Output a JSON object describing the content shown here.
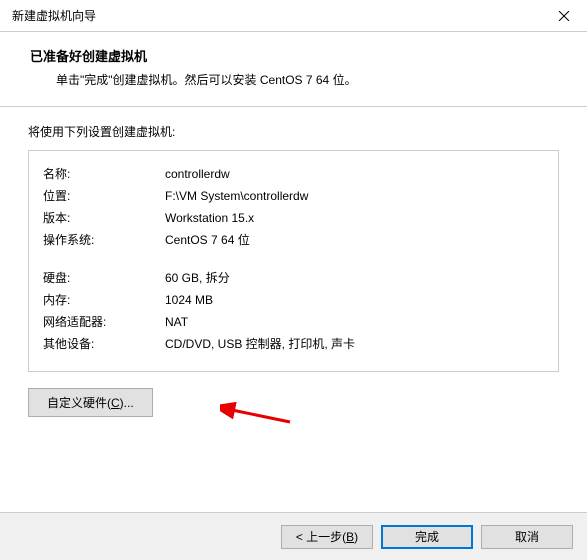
{
  "titlebar": {
    "title": "新建虚拟机向导"
  },
  "header": {
    "title": "已准备好创建虚拟机",
    "subtitle": "单击\"完成\"创建虚拟机。然后可以安装 CentOS 7 64 位。"
  },
  "content": {
    "label": "将使用下列设置创建虚拟机:",
    "settings": [
      {
        "key": "名称:",
        "value": "controllerdw"
      },
      {
        "key": "位置:",
        "value": "F:\\VM System\\controllerdw"
      },
      {
        "key": "版本:",
        "value": "Workstation 15.x"
      },
      {
        "key": "操作系统:",
        "value": "CentOS 7 64 位"
      }
    ],
    "settings2": [
      {
        "key": "硬盘:",
        "value": "60 GB, 拆分"
      },
      {
        "key": "内存:",
        "value": "1024 MB"
      },
      {
        "key": "网络适配器:",
        "value": "NAT"
      },
      {
        "key": "其他设备:",
        "value": "CD/DVD, USB 控制器, 打印机, 声卡"
      }
    ],
    "customize_label_pre": "自定义硬件(",
    "customize_label_key": "C",
    "customize_label_post": ")..."
  },
  "footer": {
    "back_pre": "< 上一步(",
    "back_key": "B",
    "back_post": ")",
    "finish": "完成",
    "cancel": "取消"
  }
}
